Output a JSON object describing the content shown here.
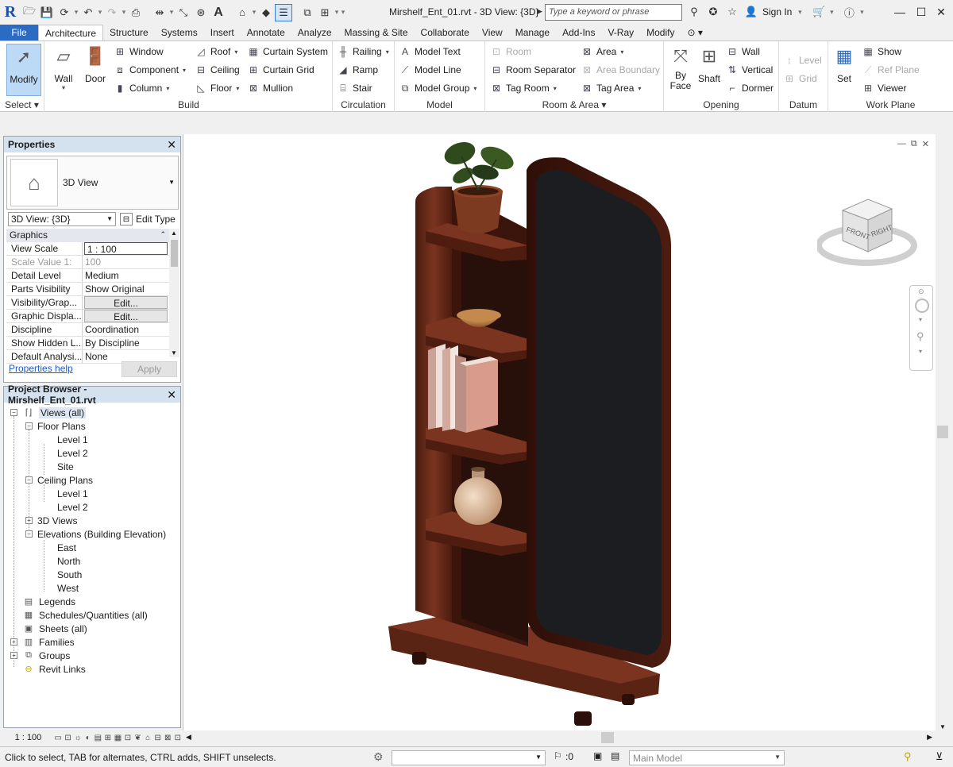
{
  "app": {
    "logo": "R",
    "title": "Mirshelf_Ent_01.rvt - 3D View: {3D}",
    "search_placeholder": "Type a keyword or phrase",
    "sign_in": "Sign In"
  },
  "tabs": [
    "File",
    "Architecture",
    "Structure",
    "Systems",
    "Insert",
    "Annotate",
    "Analyze",
    "Massing & Site",
    "Collaborate",
    "View",
    "Manage",
    "Add-Ins",
    "V-Ray",
    "Modify"
  ],
  "ribbon": {
    "select": {
      "modify": "Modify",
      "title": "Select"
    },
    "build": {
      "title": "Build",
      "wall": "Wall",
      "door": "Door",
      "window": "Window",
      "component": "Component",
      "column": "Column",
      "roof": "Roof",
      "ceiling": "Ceiling",
      "floor": "Floor",
      "curtain_system": "Curtain System",
      "curtain_grid": "Curtain Grid",
      "mullion": "Mullion"
    },
    "circulation": {
      "title": "Circulation",
      "railing": "Railing",
      "ramp": "Ramp",
      "stair": "Stair"
    },
    "model": {
      "title": "Model",
      "model_text": "Model Text",
      "model_line": "Model Line",
      "model_group": "Model Group"
    },
    "room_area": {
      "title": "Room & Area",
      "room": "Room",
      "room_separator": "Room Separator",
      "tag_room": "Tag Room",
      "area": "Area",
      "area_boundary": "Area Boundary",
      "tag_area": "Tag Area"
    },
    "opening": {
      "title": "Opening",
      "by_face_1": "By",
      "by_face_2": "Face",
      "shaft": "Shaft",
      "wall": "Wall",
      "vertical": "Vertical",
      "dormer": "Dormer"
    },
    "datum": {
      "title": "Datum",
      "level": "Level",
      "grid": "Grid"
    },
    "work_plane": {
      "title": "Work Plane",
      "set": "Set",
      "show": "Show",
      "ref_plane": "Ref Plane",
      "viewer": "Viewer"
    }
  },
  "properties": {
    "title": "Properties",
    "type_name": "3D View",
    "view_selector": "3D View: {3D}",
    "edit_type": "Edit Type",
    "group": "Graphics",
    "rows": [
      {
        "key": "View Scale",
        "value": "1 : 100"
      },
      {
        "key": "Scale Value    1:",
        "value": "100"
      },
      {
        "key": "Detail Level",
        "value": "Medium"
      },
      {
        "key": "Parts Visibility",
        "value": "Show Original"
      },
      {
        "key": "Visibility/Grap...",
        "value": "Edit..."
      },
      {
        "key": "Graphic Displa...",
        "value": "Edit..."
      },
      {
        "key": "Discipline",
        "value": "Coordination"
      },
      {
        "key": "Show Hidden L...",
        "value": "By Discipline"
      },
      {
        "key": "Default Analysi...",
        "value": "None"
      }
    ],
    "help": "Properties help",
    "apply": "Apply"
  },
  "browser": {
    "title": "Project Browser - Mirshelf_Ent_01.rvt",
    "nodes": [
      "Views (all)",
      "Floor Plans",
      "Level 1",
      "Level 2",
      "Site",
      "Ceiling Plans",
      "Level 1",
      "Level 2",
      "3D Views",
      "Elevations (Building Elevation)",
      "East",
      "North",
      "South",
      "West",
      "Legends",
      "Schedules/Quantities (all)",
      "Sheets (all)",
      "Families",
      "Groups",
      "Revit Links"
    ]
  },
  "viewcube": {
    "front": "FRONT",
    "right": "RIGHT"
  },
  "viewbar": {
    "scale": "1 : 100"
  },
  "status": {
    "text": "Click to select, TAB for alternates, CTRL adds, SHIFT unselects.",
    "filter_count": ":0",
    "model": "Main Model"
  },
  "colors": {
    "accent": "#2b6bc4",
    "wood": "#6b2c18",
    "mirror": "#1c1d21"
  }
}
